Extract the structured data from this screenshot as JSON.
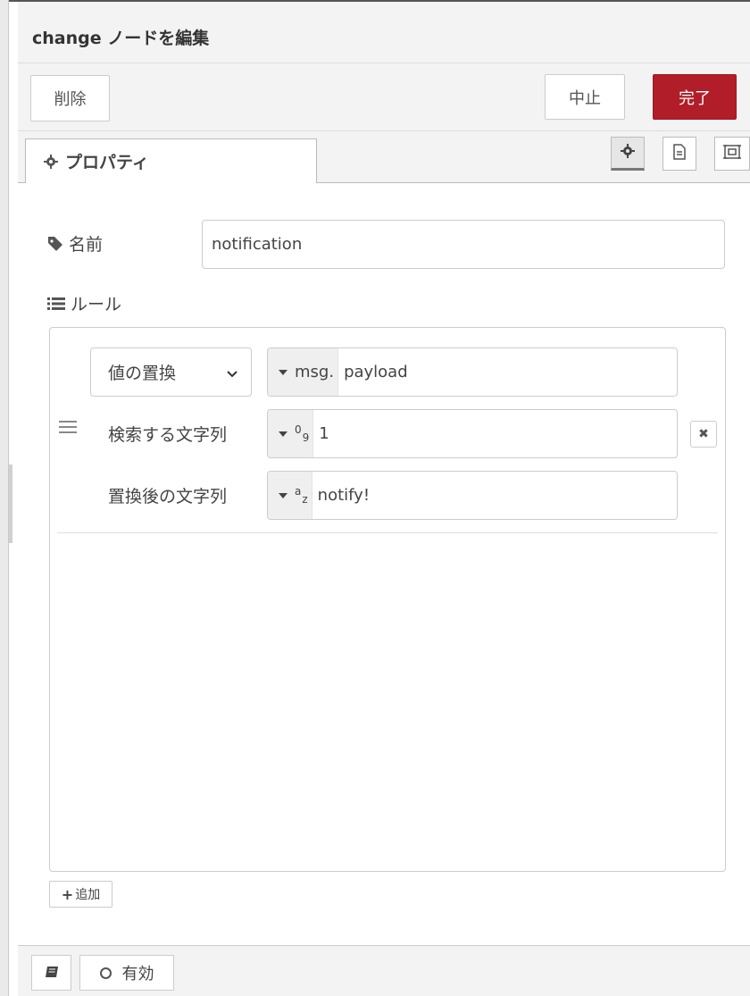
{
  "dialog": {
    "title": "change ノードを編集"
  },
  "toolbar": {
    "delete_label": "削除",
    "cancel_label": "中止",
    "done_label": "完了"
  },
  "tabs": {
    "properties_label": "プロパティ",
    "icons": [
      "gear-icon",
      "description-icon",
      "appearance-icon"
    ]
  },
  "form": {
    "name_label": "名前",
    "name_value": "notification",
    "rules_label": "ルール"
  },
  "rule": {
    "action": "値の置換",
    "target_prefix": "msg.",
    "target_value": "payload",
    "search_label": "検索する文字列",
    "search_type_icon_top": "0",
    "search_type_icon_bottom": "9",
    "search_value": "1",
    "replace_label": "置換後の文字列",
    "replace_type_icon_top": "a",
    "replace_type_icon_bottom": "z",
    "replace_value": "notify!"
  },
  "add_button": {
    "label": "追加"
  },
  "footer": {
    "enabled_label": "有効"
  },
  "colors": {
    "done_button": "#b11d28",
    "panel_background": "#f3f3f3"
  }
}
